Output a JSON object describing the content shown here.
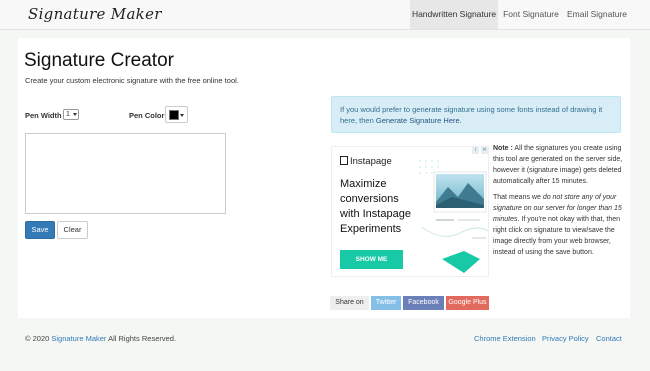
{
  "nav": {
    "brand": "Signature Maker",
    "items": [
      {
        "label": "Handwritten Signature",
        "active": true
      },
      {
        "label": "Font Signature",
        "active": false
      },
      {
        "label": "Email Signature",
        "active": false
      }
    ]
  },
  "main": {
    "title": "Signature Creator",
    "subtitle": "Create your custom electronic signature with the free online tool.",
    "pen_width_label": "Pen Width",
    "pen_width_value": "1",
    "pen_color_label": "Pen Color",
    "pen_color_value": "#000000",
    "save_label": "Save",
    "clear_label": "Clear"
  },
  "info": {
    "text": "If you would prefer to generate signature using some fonts instead of drawing it here, then",
    "link": "Generate Signature Here."
  },
  "ad": {
    "logo": "Instapage",
    "headline": "Maximize conversions with Instapage Experiments",
    "cta": "SHOW ME",
    "accent": "#17c9a4"
  },
  "note": {
    "label": "Note :",
    "p1": "All the signatures you create using this tool are generated on the server side, however it (signature image) gets deleted automatically after 15 minutes.",
    "p2_start": "That means we",
    "p2_italic": "do not store any of your signature on our server for longer than 15 minutes",
    "p2_end": ". If you're not okay with that, then right click on signature to view/save the image directly from your web browser, instead of using the save button."
  },
  "share": {
    "label": "Share on",
    "twitter": "Twitter",
    "facebook": "Facebook",
    "gplus": "Google Plus"
  },
  "footer": {
    "copyright_prefix": "© 2020",
    "copyright_link": "Signature Maker",
    "copyright_suffix": "All Rights Reserved.",
    "links": [
      "Chrome Extension",
      "Privacy Policy",
      "Contact"
    ]
  }
}
